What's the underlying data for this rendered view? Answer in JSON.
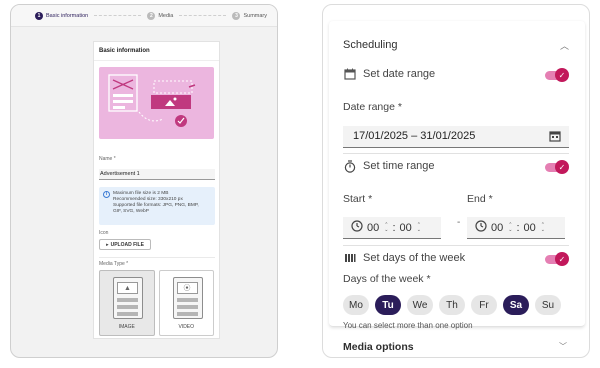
{
  "stepper": {
    "steps": [
      {
        "num": "1",
        "label": "Basic information"
      },
      {
        "num": "2",
        "label": "Media"
      },
      {
        "num": "3",
        "label": "Summary"
      }
    ]
  },
  "form": {
    "title": "Basic information",
    "name_label": "Name *",
    "name_value": "Advertisement 1",
    "info_lines": [
      "Maximum file size is 2 MB",
      "Recommended size: 330x210 px",
      "Supported file formats: JPG, PNG, BMP,",
      "GIF, SVG, WebP"
    ],
    "icon_label": "Icon",
    "upload_label": "UPLOAD FILE",
    "media_type_label": "Media Type *",
    "media_options": [
      "IMAGE",
      "VIDEO"
    ],
    "media_selected": "IMAGE"
  },
  "scheduling": {
    "title": "Scheduling",
    "set_date_range": "Set date range",
    "date_range_label": "Date range *",
    "date_range_value": "17/01/2025 – 31/01/2025",
    "set_time_range": "Set time range",
    "start_label": "Start *",
    "end_label": "End *",
    "start_hours": "00",
    "start_minutes": "00",
    "end_hours": "00",
    "end_minutes": "00",
    "time_separator": ":",
    "range_dash": "-",
    "set_days": "Set days of the week",
    "days_label": "Days of the week *",
    "days": [
      "Mo",
      "Tu",
      "We",
      "Th",
      "Fr",
      "Sa",
      "Su"
    ],
    "selected_days": [
      "Tu",
      "Sa"
    ],
    "hint": "You can select more than one option",
    "toggles_on": [
      true,
      true,
      true
    ]
  },
  "media_options_title": "Media options",
  "colors": {
    "accent": "#c2185b",
    "selected_day": "#2b1d5a",
    "hero_bg": "#ecb6df"
  }
}
